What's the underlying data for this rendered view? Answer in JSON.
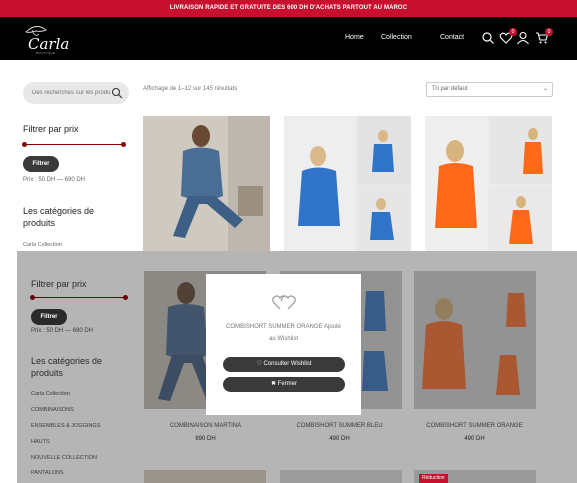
{
  "topbar": {
    "text": "LIVRAISON RAPIDE ET GRATUITE DES 600 DH D'ACHATS PARTOUT AU MAROC"
  },
  "brand": {
    "name": "Carla",
    "sub": "BOUTIQUE"
  },
  "nav": {
    "home": "Home",
    "collection": "Collection",
    "contact": "Contact"
  },
  "badges": {
    "wishlist": "0",
    "cart": "0"
  },
  "search": {
    "placeholder": "Des recherches sur les produits"
  },
  "results": {
    "text": "Affichage de 1–12 sur 145 résultats"
  },
  "sort": {
    "selected": "Tri par défaut"
  },
  "sidebar": {
    "filter_title": "Filtrer par prix",
    "filter_button": "Filtrer",
    "price_range": "Prix : 50 DH — 690 DH",
    "categories_title": "Les catégories de produits",
    "categories": [
      "Carla Collection",
      "COMBINAISONS",
      "ENSEMBLES & JOGGINGS",
      "HAUTS",
      "NOUVELLE COLLECTION",
      "PANTALONS"
    ]
  },
  "products": [
    {
      "name": "COMBINAISON MARTINA",
      "price": "690 DH"
    },
    {
      "name": "COMBISHORT SUMMER BLEU",
      "price": "490 DH"
    },
    {
      "name": "COMBISHORT SUMMER ORANGE",
      "price": "490 DH"
    }
  ],
  "modal": {
    "message_line1": "COMBISHORT SUMMER ORANGE Ajouté",
    "message_line2": "au Wishlist",
    "view_wishlist": "Consulter Wishlist",
    "close": "Fermer"
  },
  "badge_reduction": "Réduction",
  "colors": {
    "accent": "#c8102e",
    "header": "#000000",
    "button": "#3a3a3a"
  }
}
